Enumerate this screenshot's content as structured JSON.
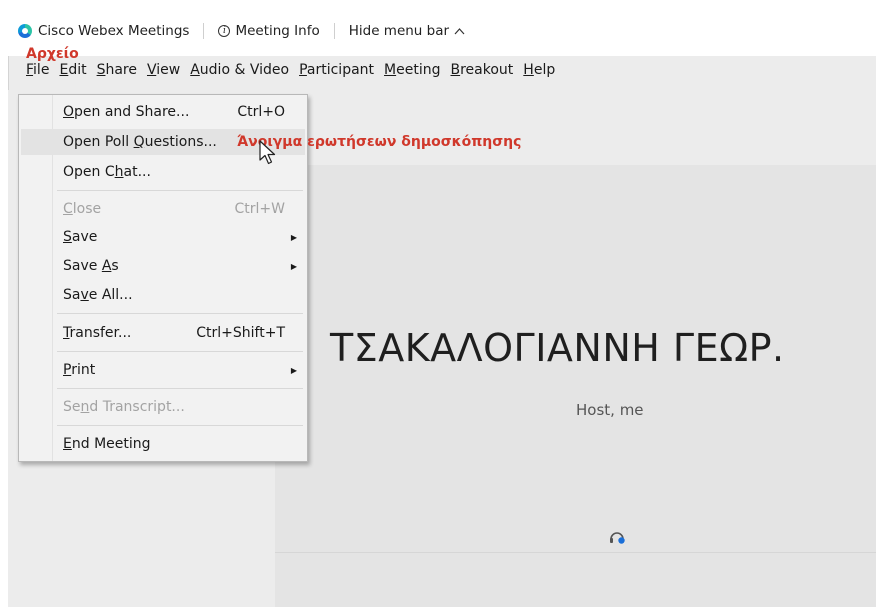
{
  "titlebar": {
    "app_name": "Cisco Webex Meetings",
    "meeting_info": "Meeting Info",
    "hide_menu_bar": "Hide menu bar",
    "chevron": "^"
  },
  "annotations": {
    "file_greek": "Αρχείο",
    "open_poll_greek": "Άνοιγμα ερωτήσεων δημοσκόπησης"
  },
  "menubar": {
    "file": "File",
    "edit": "Edit",
    "share": "Share",
    "view": "View",
    "audio_video": "Audio & Video",
    "participant": "Participant",
    "meeting": "Meeting",
    "breakout": "Breakout",
    "help": "Help"
  },
  "file_menu": {
    "open_and_share": "Open and Share...",
    "open_and_share_shortcut": "Ctrl+O",
    "open_poll": "Open Poll Questions...",
    "open_chat": "Open Chat...",
    "close": "Close",
    "close_shortcut": "Ctrl+W",
    "save": "Save",
    "save_as": "Save As",
    "save_all": "Save All...",
    "transfer": "Transfer...",
    "transfer_shortcut": "Ctrl+Shift+T",
    "print": "Print",
    "send_transcript": "Send Transcript...",
    "end_meeting": "End Meeting"
  },
  "stage": {
    "participant_name": "ΤΣΑΚΑΛΟΓΙΑΝΝΗ ΓΕΩΡ.",
    "participant_role": "Host, me"
  },
  "colors": {
    "annotation_red": "#d0382b",
    "menu_bg": "#f2f2f2",
    "highlight": "#e3e3e3",
    "audio_icon_blue": "#1b6fd8"
  },
  "icons": {
    "logo": "webex-logo",
    "info": "info-icon",
    "submenu": "submenu-arrow-icon",
    "cursor": "mouse-cursor-icon",
    "audio": "headset-audio-icon"
  }
}
